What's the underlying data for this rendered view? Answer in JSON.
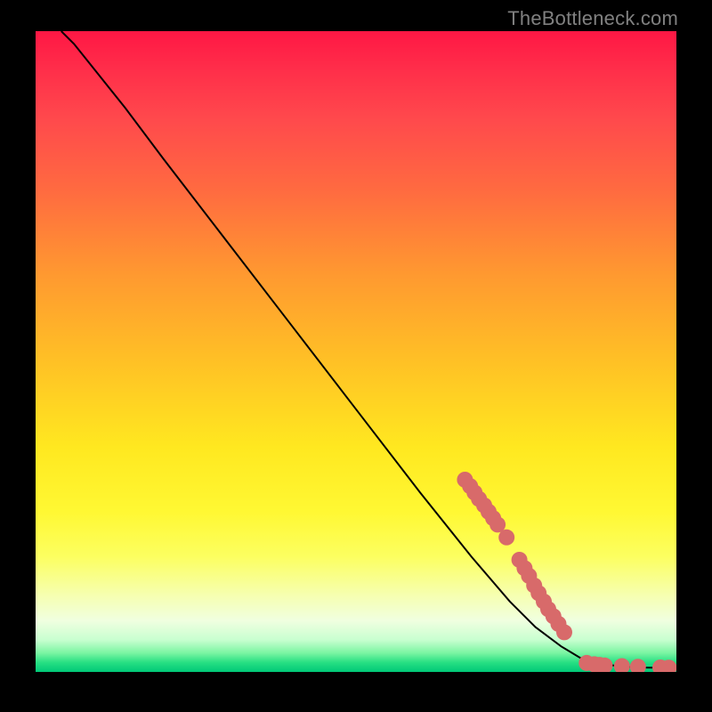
{
  "watermark": "TheBottleneck.com",
  "colors": {
    "curve": "#000000",
    "point_fill": "#d86a6a",
    "point_stroke": "#b74f4f"
  },
  "chart_data": {
    "type": "line",
    "title": "",
    "xlabel": "",
    "ylabel": "",
    "xlim": [
      0,
      100
    ],
    "ylim": [
      0,
      100
    ],
    "curve": [
      {
        "x": 4,
        "y": 100
      },
      {
        "x": 6,
        "y": 98
      },
      {
        "x": 8,
        "y": 95.5
      },
      {
        "x": 10,
        "y": 93
      },
      {
        "x": 14,
        "y": 88
      },
      {
        "x": 20,
        "y": 80
      },
      {
        "x": 30,
        "y": 67
      },
      {
        "x": 40,
        "y": 54
      },
      {
        "x": 50,
        "y": 41
      },
      {
        "x": 60,
        "y": 28
      },
      {
        "x": 68,
        "y": 18
      },
      {
        "x": 74,
        "y": 11
      },
      {
        "x": 78,
        "y": 7
      },
      {
        "x": 82,
        "y": 4
      },
      {
        "x": 85,
        "y": 2.2
      },
      {
        "x": 88,
        "y": 1.3
      },
      {
        "x": 91,
        "y": 0.9
      },
      {
        "x": 94,
        "y": 0.7
      },
      {
        "x": 97,
        "y": 0.65
      },
      {
        "x": 100,
        "y": 0.62
      }
    ],
    "points": [
      {
        "x": 67.0,
        "y": 30.0
      },
      {
        "x": 67.8,
        "y": 29.0
      },
      {
        "x": 68.5,
        "y": 28.0
      },
      {
        "x": 69.2,
        "y": 27.0
      },
      {
        "x": 70.0,
        "y": 26.0
      },
      {
        "x": 70.7,
        "y": 25.0
      },
      {
        "x": 71.4,
        "y": 24.0
      },
      {
        "x": 72.1,
        "y": 23.0
      },
      {
        "x": 73.5,
        "y": 21.0
      },
      {
        "x": 75.5,
        "y": 17.5
      },
      {
        "x": 76.3,
        "y": 16.2
      },
      {
        "x": 77.0,
        "y": 15.0
      },
      {
        "x": 77.8,
        "y": 13.5
      },
      {
        "x": 78.5,
        "y": 12.3
      },
      {
        "x": 79.3,
        "y": 11.0
      },
      {
        "x": 80.0,
        "y": 9.8
      },
      {
        "x": 80.8,
        "y": 8.7
      },
      {
        "x": 81.6,
        "y": 7.5
      },
      {
        "x": 82.5,
        "y": 6.2
      },
      {
        "x": 86.0,
        "y": 1.4
      },
      {
        "x": 87.2,
        "y": 1.2
      },
      {
        "x": 88.0,
        "y": 1.1
      },
      {
        "x": 88.8,
        "y": 1.0
      },
      {
        "x": 91.5,
        "y": 0.9
      },
      {
        "x": 94.0,
        "y": 0.8
      },
      {
        "x": 97.5,
        "y": 0.7
      },
      {
        "x": 98.8,
        "y": 0.66
      }
    ],
    "point_radius": 9
  }
}
